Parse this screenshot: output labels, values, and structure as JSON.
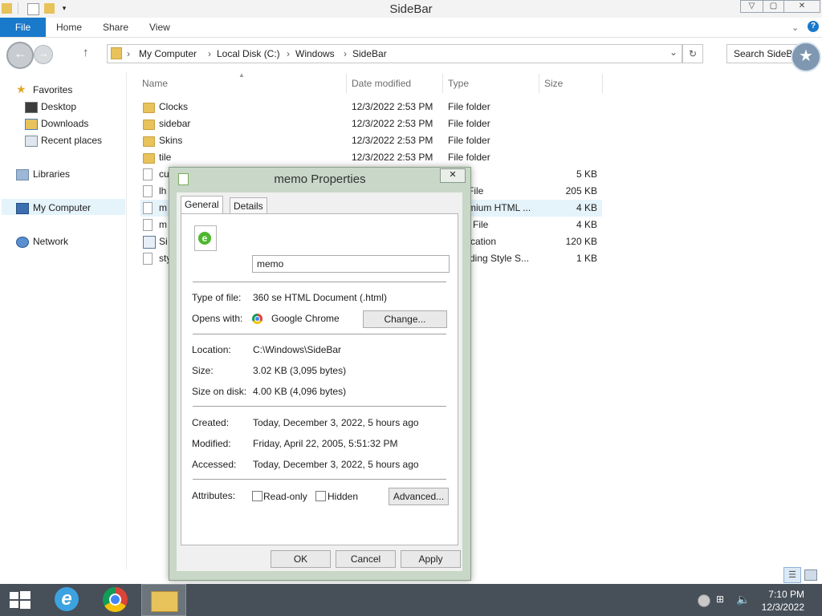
{
  "window": {
    "title": "SideBar"
  },
  "ribbon": {
    "tabs": [
      "File",
      "Home",
      "Share",
      "View"
    ]
  },
  "address": {
    "crumbs": [
      "My Computer",
      "Local Disk (C:)",
      "Windows",
      "SideBar"
    ],
    "search_placeholder": "Search SideBar"
  },
  "nav": {
    "favorites": "Favorites",
    "desktop": "Desktop",
    "downloads": "Downloads",
    "recent": "Recent places",
    "libraries": "Libraries",
    "computer": "My Computer",
    "network": "Network"
  },
  "columns": {
    "name": "Name",
    "date": "Date modified",
    "type": "Type",
    "size": "Size"
  },
  "files": [
    {
      "name": "Clocks",
      "date": "12/3/2022 2:53 PM",
      "type": "File folder",
      "size": "",
      "icon": "folder"
    },
    {
      "name": "sidebar",
      "date": "12/3/2022 2:53 PM",
      "type": "File folder",
      "size": "",
      "icon": "folder"
    },
    {
      "name": "Skins",
      "date": "12/3/2022 2:53 PM",
      "type": "File folder",
      "size": "",
      "icon": "folder"
    },
    {
      "name": "tile",
      "date": "12/3/2022 2:53 PM",
      "type": "File folder",
      "size": "",
      "icon": "folder"
    },
    {
      "name": "cu",
      "date": "",
      "type": "r",
      "size": "5 KB",
      "icon": "doc"
    },
    {
      "name": "lh",
      "date": "",
      "type": "File",
      "size": "205 KB",
      "icon": "doc"
    },
    {
      "name": "m",
      "date": "",
      "type": "mium HTML ...",
      "size": "4 KB",
      "icon": "doc"
    },
    {
      "name": "m",
      "date": "",
      "type": "File",
      "size": "4 KB",
      "icon": "doc"
    },
    {
      "name": "Si",
      "date": "",
      "type": "cation",
      "size": "120 KB",
      "icon": "app"
    },
    {
      "name": "sty",
      "date": "",
      "type": "ding Style S...",
      "size": "1 KB",
      "icon": "doc"
    }
  ],
  "dialog": {
    "title": "memo Properties",
    "tabs": [
      "General",
      "Details"
    ],
    "filename": "memo",
    "type_label": "Type of file:",
    "type_value": "360 se HTML Document (.html)",
    "opens_label": "Opens with:",
    "opens_value": "Google Chrome",
    "change_button": "Change...",
    "location_label": "Location:",
    "location_value": "C:\\Windows\\SideBar",
    "size_label": "Size:",
    "size_value": "3.02 KB (3,095 bytes)",
    "disk_label": "Size on disk:",
    "disk_value": "4.00 KB (4,096 bytes)",
    "created_label": "Created:",
    "created_value": "Today, December 3, 2022, 5 hours ago",
    "modified_label": "Modified:",
    "modified_value": "Friday, April 22, 2005, 5:51:32 PM",
    "accessed_label": "Accessed:",
    "accessed_value": "Today, December 3, 2022, 5 hours ago",
    "attributes_label": "Attributes:",
    "readonly_label": "Read-only",
    "hidden_label": "Hidden",
    "advanced_button": "Advanced...",
    "ok_button": "OK",
    "cancel_button": "Cancel",
    "apply_button": "Apply"
  },
  "taskbar": {
    "time": "7:10 PM",
    "date": "12/3/2022"
  }
}
